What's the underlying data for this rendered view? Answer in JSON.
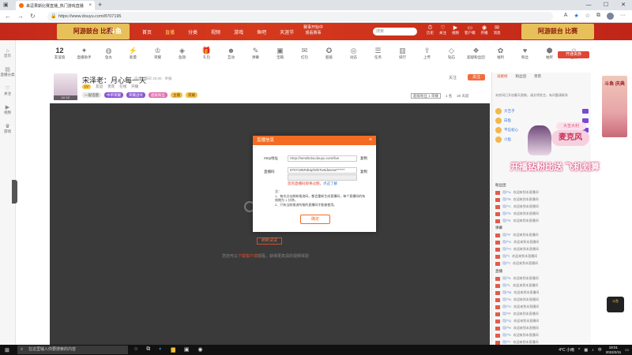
{
  "browser": {
    "tab_title": "来逗果斯比赛直播_热门游戏直播",
    "tab_close": "×",
    "new_tab": "+",
    "url": "https://www.douyu.com/8707195",
    "window_controls": [
      "—",
      "☐",
      "✕"
    ]
  },
  "header": {
    "banner_left": "阿游鼓台 比赛",
    "logo": "斗鱼",
    "nav": [
      "首页",
      "直播",
      "分类",
      "视频",
      "游戏",
      "鱼吧",
      "天涯节"
    ],
    "nav_active_index": 1,
    "promo": [
      "赛事开始中",
      "观看赛事"
    ],
    "search_placeholder": "搜索",
    "icons": [
      {
        "icon": "history-icon",
        "label": "历史"
      },
      {
        "icon": "follow-icon",
        "label": "关注"
      },
      {
        "icon": "video-icon",
        "label": "视频"
      },
      {
        "icon": "customer-icon",
        "label": "客户端"
      },
      {
        "icon": "live-icon",
        "label": "开播"
      },
      {
        "icon": "message-icon",
        "label": "消息"
      }
    ],
    "banner_right": "阿游鼓台 比赛"
  },
  "leftbar": [
    {
      "icon": "home-icon",
      "label": "首页"
    },
    {
      "icon": "live-icon",
      "label": "直播分类"
    },
    {
      "icon": "follow-icon",
      "label": "关注"
    },
    {
      "icon": "video-icon",
      "label": "视频"
    },
    {
      "icon": "game-icon",
      "label": "游戏"
    }
  ],
  "giftbar": {
    "count": "12",
    "count_label": "友谊值",
    "items": [
      "直播助手",
      "鱼丸",
      "能量",
      "荣耀",
      "鱼翅",
      "礼包",
      "互动",
      "弹幕",
      "宝箱",
      "红包",
      "超级",
      "动态",
      "任务",
      "排行",
      "上传",
      "钻石",
      "超级粉丝团",
      "福利",
      "粉丝",
      "抽奖",
      "主播"
    ],
    "vip_label": "开通贵族"
  },
  "streamer": {
    "avatar_label": "LV 12",
    "title": "宋泽老：月心每一天",
    "room_info": "房间 · 每日 20:00 · 举报",
    "meta": [
      "友谊",
      "贵宾",
      "在线",
      "开播"
    ],
    "level_badge": "LV",
    "tags": [
      "一般话题",
      "中单荣耀",
      "荣耀战令",
      "超级粉丝",
      "主播",
      "荣耀"
    ],
    "follow_count": "关注",
    "follow_button": "关注",
    "rank_labels": [
      "超级粉丝 1 荣耀",
      "1 名",
      "20 天前"
    ]
  },
  "video": {
    "retry_label": "刷新试试",
    "hint_prefix": "您还可以",
    "hint_link": "下载客户端",
    "hint_suffix": "观看，获得更高清的视频体验"
  },
  "modal": {
    "title": "直播信息",
    "close": "×",
    "rtmp_label": "rtmp地址",
    "rtmp_value": "rtmp://sendtc3a.douyu.com/live",
    "copy_label": "复制",
    "key_label": "直播码",
    "key_value": "8707195Rdtaph0bTw5dws4w******",
    "warn_text": "您的直播码即将过期，",
    "warn_link": "点这了解",
    "notes": [
      "注：",
      "1、每次点击刷新推流码，都会重新生成直播码，每个直播码的有效期为 1 分钟。",
      "2、只有当前推流所推的直播码才能被使用。"
    ],
    "confirm": "确定"
  },
  "rightpanel": {
    "tabs": [
      "贡献榜",
      "粉丝团",
      "贵宾"
    ],
    "notice": "本房间已开启聊天限制，请文明发言，有问题请联系",
    "top_rows": [
      "大吉子",
      "白鱼",
      "不忘初心",
      "小鱼"
    ],
    "section_labels": [
      "粉丝团",
      "弹幕",
      "直播"
    ],
    "chat": [
      {
        "user": "用户A",
        "text": "欢迎来到本直播间"
      },
      {
        "user": "用户B",
        "text": "欢迎来到本直播间"
      },
      {
        "user": "用户C",
        "text": "欢迎来到本直播间"
      },
      {
        "user": "用户D",
        "text": "欢迎来到本直播间"
      },
      {
        "user": "用户E",
        "text": "欢迎来到本直播间"
      },
      {
        "user": "用户F",
        "text": "欢迎来到本直播间"
      },
      {
        "user": "用户G",
        "text": "欢迎来到本直播间"
      },
      {
        "user": "用户H",
        "text": "欢迎来到本直播间"
      },
      {
        "user": "用户I",
        "text": "欢迎来到本直播间"
      },
      {
        "user": "用户J",
        "text": "欢迎来到本直播间"
      },
      {
        "user": "用户K",
        "text": "欢迎来到本直播间"
      },
      {
        "user": "用户L",
        "text": "欢迎来到本直播间"
      },
      {
        "user": "用户M",
        "text": "欢迎来到本直播间"
      },
      {
        "user": "用户N",
        "text": "欢迎来到本直播间"
      },
      {
        "user": "用户O",
        "text": "欢迎来到本直播间"
      },
      {
        "user": "用户P",
        "text": "欢迎来到本直播间"
      },
      {
        "user": "用户Q",
        "text": "欢迎来到本直播间"
      },
      {
        "user": "用户R",
        "text": "欢迎来到本直播间"
      },
      {
        "user": "用户S",
        "text": "欢迎来到本直播间"
      },
      {
        "user": "用户T",
        "text": "欢迎来到本直播间"
      }
    ]
  },
  "overlay": {
    "bubble": "大吉大利",
    "badge": "麦克风",
    "caption": "开播钻粉比送 飞机划算",
    "poster": "斗鱼 庆典"
  },
  "taskbar": {
    "search_placeholder": "在这里输入你要搜索的内容",
    "weather": "4°C 小雨",
    "lang": "中",
    "time": "19:01",
    "date": "2022/2/11"
  }
}
